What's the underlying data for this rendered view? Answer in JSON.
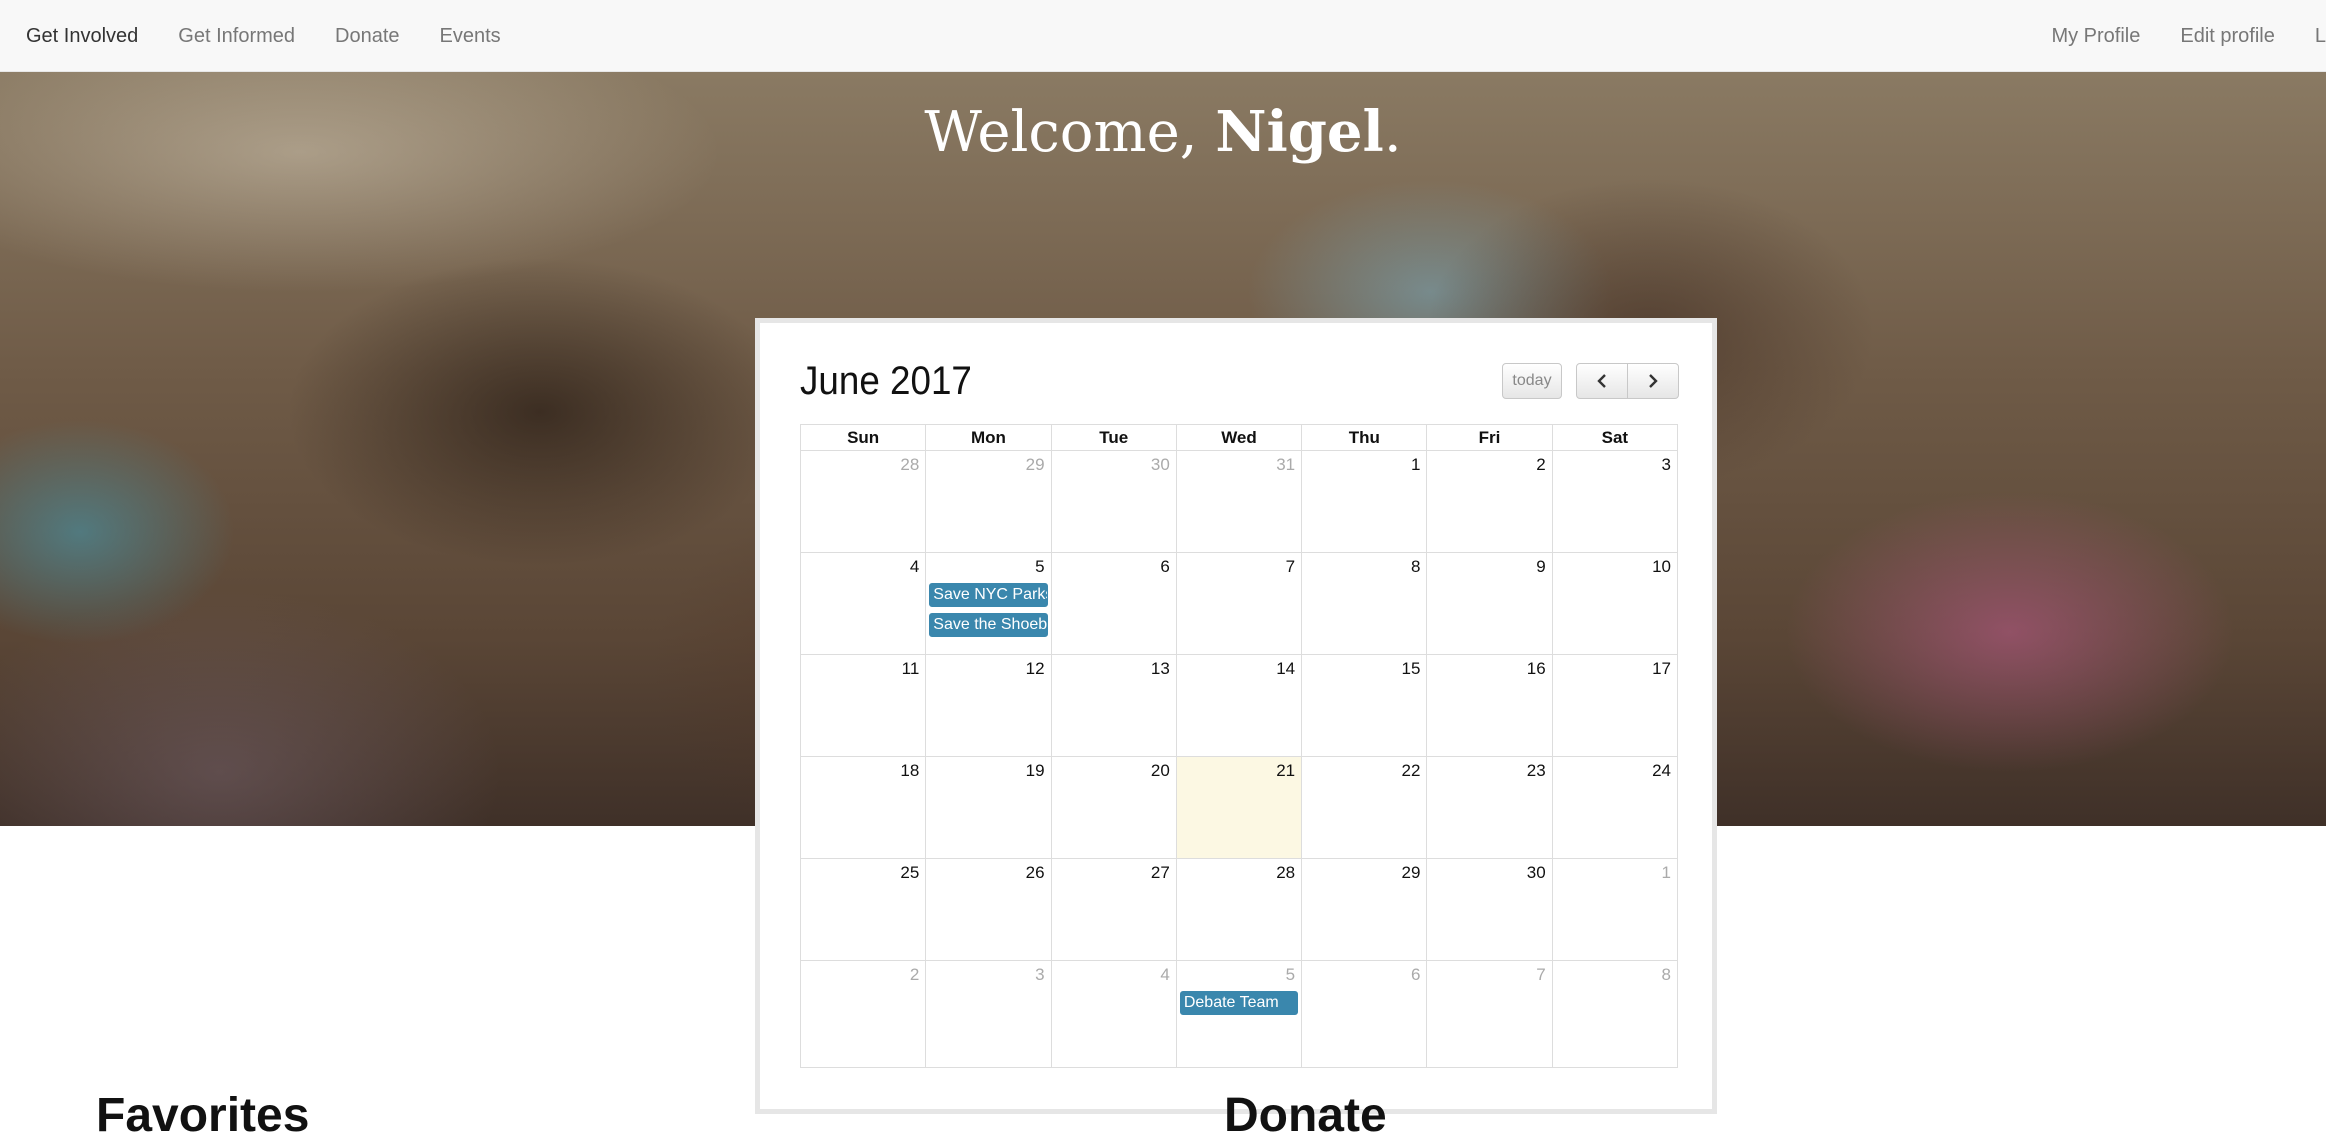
{
  "nav": {
    "left": [
      "Get Involved",
      "Get Informed",
      "Donate",
      "Events"
    ],
    "right": [
      "My Profile",
      "Edit profile",
      "L"
    ]
  },
  "hero": {
    "welcome_prefix": "Welcome, ",
    "user_name": "Nigel",
    "welcome_suffix": "."
  },
  "calendar": {
    "title": "June 2017",
    "today_label": "today",
    "prev_icon": "chevron-left-icon",
    "next_icon": "chevron-right-icon",
    "weekdays": [
      "Sun",
      "Mon",
      "Tue",
      "Wed",
      "Thu",
      "Fri",
      "Sat"
    ],
    "weeks": [
      [
        {
          "d": "28",
          "other": true
        },
        {
          "d": "29",
          "other": true
        },
        {
          "d": "30",
          "other": true
        },
        {
          "d": "31",
          "other": true
        },
        {
          "d": "1"
        },
        {
          "d": "2"
        },
        {
          "d": "3"
        }
      ],
      [
        {
          "d": "4"
        },
        {
          "d": "5",
          "events": [
            "Save NYC Parks",
            "Save the Shoebil"
          ]
        },
        {
          "d": "6"
        },
        {
          "d": "7"
        },
        {
          "d": "8"
        },
        {
          "d": "9"
        },
        {
          "d": "10"
        }
      ],
      [
        {
          "d": "11"
        },
        {
          "d": "12"
        },
        {
          "d": "13"
        },
        {
          "d": "14"
        },
        {
          "d": "15"
        },
        {
          "d": "16"
        },
        {
          "d": "17"
        }
      ],
      [
        {
          "d": "18"
        },
        {
          "d": "19"
        },
        {
          "d": "20"
        },
        {
          "d": "21",
          "today": true
        },
        {
          "d": "22"
        },
        {
          "d": "23"
        },
        {
          "d": "24"
        }
      ],
      [
        {
          "d": "25"
        },
        {
          "d": "26"
        },
        {
          "d": "27"
        },
        {
          "d": "28"
        },
        {
          "d": "29"
        },
        {
          "d": "30"
        },
        {
          "d": "1",
          "other": true
        }
      ],
      [
        {
          "d": "2",
          "other": true
        },
        {
          "d": "3",
          "other": true
        },
        {
          "d": "4",
          "other": true
        },
        {
          "d": "5",
          "other": true,
          "events": [
            "Debate Team"
          ]
        },
        {
          "d": "6",
          "other": true
        },
        {
          "d": "7",
          "other": true
        },
        {
          "d": "8",
          "other": true
        }
      ]
    ],
    "event_color": "#3a87ad",
    "today_color": "#fcf8e3"
  },
  "sections": {
    "favorites": "Favorites",
    "donate": "Donate"
  }
}
